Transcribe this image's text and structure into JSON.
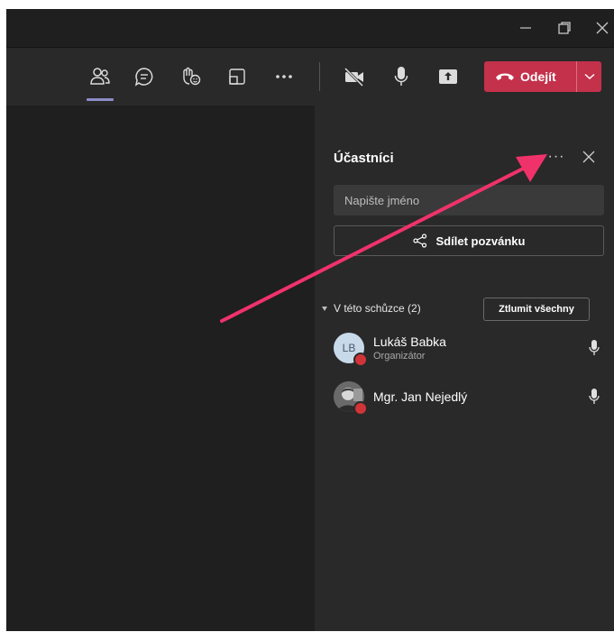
{
  "toolbar": {
    "leave_label": "Odejít"
  },
  "panel": {
    "title": "Účastníci",
    "more_label": "···",
    "search_placeholder": "Napište jméno",
    "share_label": "Sdílet pozvánku",
    "section_label": "V této schůzce (2)",
    "mute_all_label": "Ztlumit všechny",
    "participants": [
      {
        "initials": "LB",
        "name": "Lukáš Babka",
        "role": "Organizátor"
      },
      {
        "initials": "",
        "name": "Mgr. Jan Nejedlý",
        "role": ""
      }
    ]
  },
  "icons": [
    "minimize-icon",
    "restore-icon",
    "close-icon",
    "people-icon",
    "chat-icon",
    "raise-hand-icon",
    "share-tray-icon",
    "more-icon",
    "camera-off-icon",
    "microphone-icon",
    "share-screen-icon",
    "phone-hangup-icon",
    "chevron-down-icon",
    "share-icon",
    "microphone-icon"
  ],
  "colors": {
    "accent": "#8b8cc7",
    "leave": "#c4314b",
    "annotation_arrow": "#f0326b",
    "status_busy": "#d13438"
  }
}
